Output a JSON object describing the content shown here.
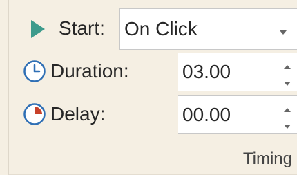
{
  "timing": {
    "start": {
      "label": "Start:",
      "value": "On Click"
    },
    "duration": {
      "label": "Duration:",
      "value": "03.00"
    },
    "delay": {
      "label": "Delay:",
      "value": "00.00"
    },
    "group_label": "Timing"
  },
  "icons": {
    "start": "play-icon",
    "duration": "clock-icon",
    "delay": "delay-clock-icon",
    "dropdown": "chevron-down-icon",
    "spin_up": "spin-up-icon",
    "spin_down": "spin-down-icon"
  },
  "colors": {
    "play": "#3d9b8c",
    "clock_blue": "#2f6fb5",
    "delay_red": "#c8412a",
    "background": "#f5efe3"
  }
}
